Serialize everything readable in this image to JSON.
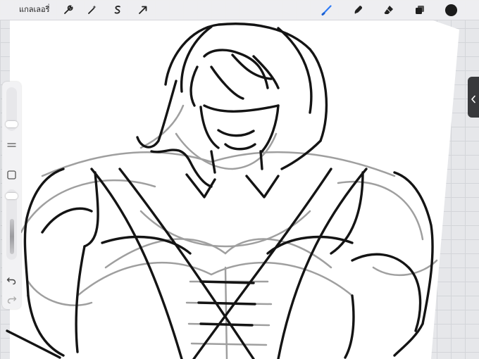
{
  "toolbar": {
    "gallery_label": "แกลเลอรี่",
    "left_icons": [
      "wrench-icon",
      "magic-wand-icon",
      "selection-s-icon",
      "transform-arrow-icon"
    ],
    "right_icons": [
      "brush-icon",
      "smudge-icon",
      "eraser-icon",
      "layers-icon",
      "color-circle-icon"
    ]
  },
  "colors": {
    "active_tool": "#2f7bf6",
    "current_color": "#1c1c1c",
    "canvas": "#ffffff",
    "background": "#e6e7ea",
    "ink": "#141414"
  },
  "sidebar": {
    "icons": [
      "menu-icon",
      "modify-square-icon",
      "undo-icon",
      "redo-icon"
    ]
  }
}
